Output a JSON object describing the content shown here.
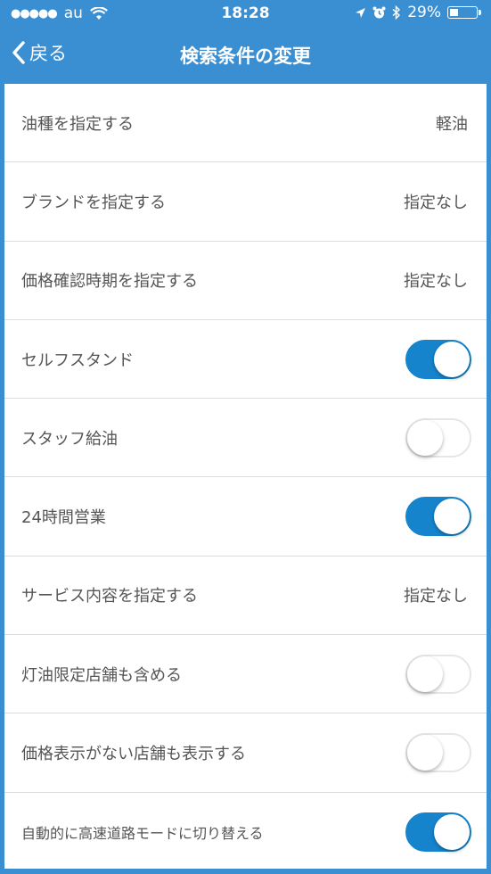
{
  "status_bar": {
    "carrier": "au",
    "time": "18:28",
    "battery": "29%"
  },
  "nav": {
    "back_label": "戻る",
    "title": "検索条件の変更"
  },
  "rows": [
    {
      "label": "油種を指定する",
      "value": "軽油"
    },
    {
      "label": "ブランドを指定する",
      "value": "指定なし"
    },
    {
      "label": "価格確認時期を指定する",
      "value": "指定なし"
    },
    {
      "label": "セルフスタンド",
      "toggle": true
    },
    {
      "label": "スタッフ給油",
      "toggle": false
    },
    {
      "label": "24時間営業",
      "toggle": true
    },
    {
      "label": "サービス内容を指定する",
      "value": "指定なし"
    },
    {
      "label": "灯油限定店舗も含める",
      "toggle": false
    },
    {
      "label": "価格表示がない店舗も表示する",
      "toggle": false
    },
    {
      "label": "自動的に高速道路モードに切り替える",
      "toggle": true
    }
  ],
  "colors": {
    "nav_bg": "#3a8fd3",
    "toggle_on": "#1584cd"
  }
}
